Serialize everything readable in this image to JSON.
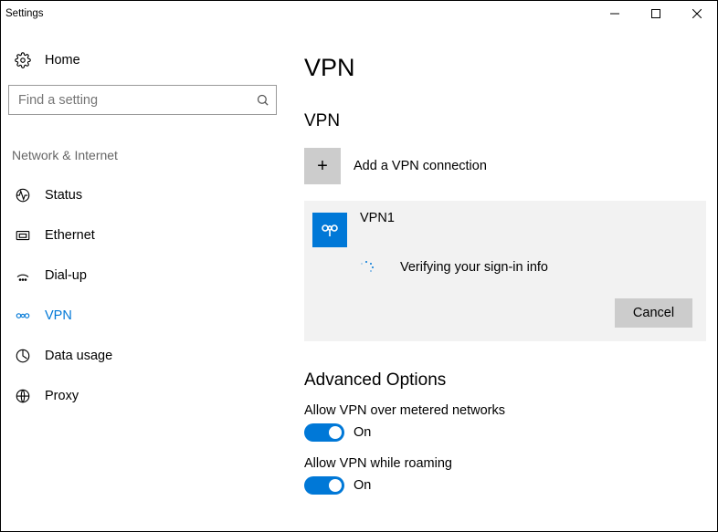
{
  "window": {
    "title": "Settings"
  },
  "sidebar": {
    "home": "Home",
    "search_placeholder": "Find a setting",
    "section": "Network & Internet",
    "items": [
      {
        "label": "Status"
      },
      {
        "label": "Ethernet"
      },
      {
        "label": "Dial-up"
      },
      {
        "label": "VPN"
      },
      {
        "label": "Data usage"
      },
      {
        "label": "Proxy"
      }
    ]
  },
  "main": {
    "title": "VPN",
    "list_heading": "VPN",
    "add_label": "Add a VPN connection",
    "connection": {
      "name": "VPN1",
      "status": "Verifying your sign-in info",
      "cancel": "Cancel"
    },
    "advanced": {
      "title": "Advanced Options",
      "metered_label": "Allow VPN over metered networks",
      "metered_state": "On",
      "roaming_label": "Allow VPN while roaming",
      "roaming_state": "On"
    }
  }
}
